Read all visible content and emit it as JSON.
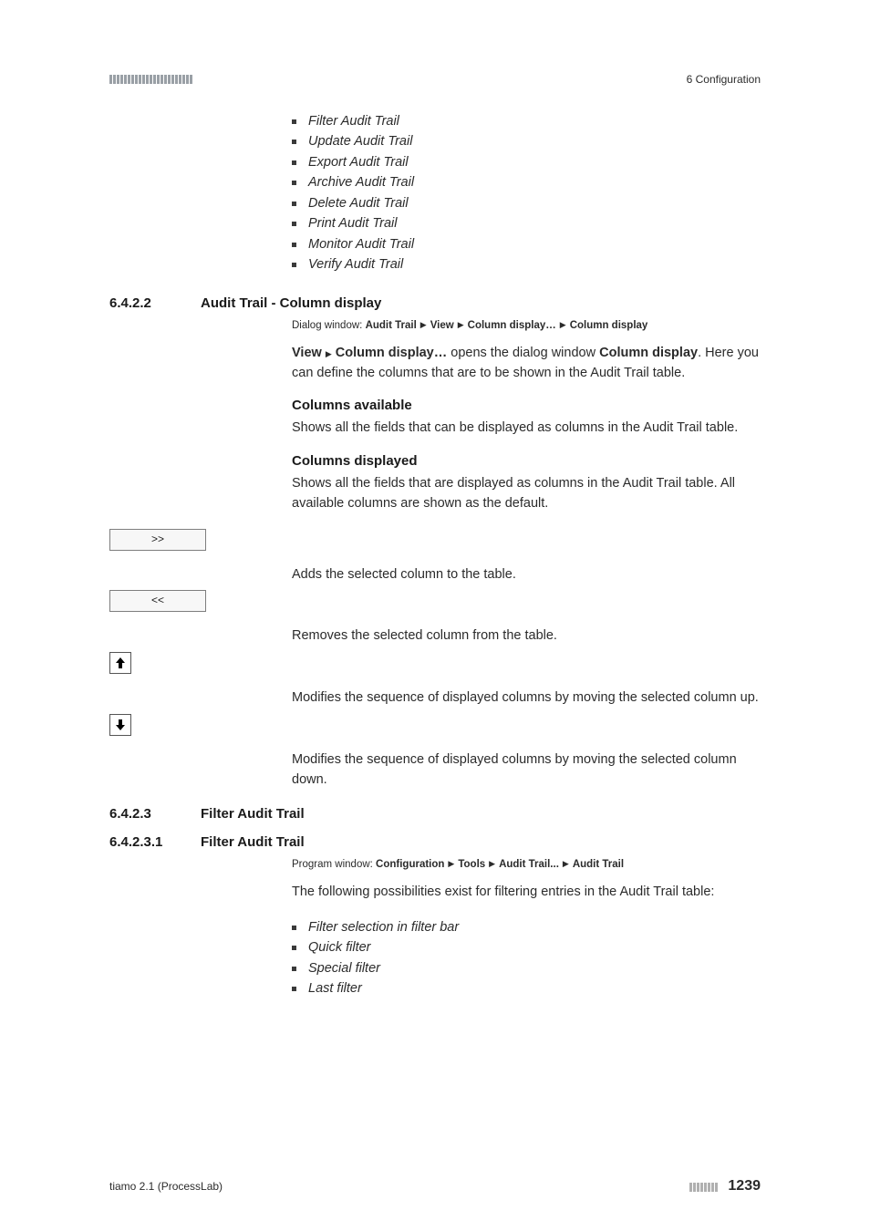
{
  "header": {
    "chapter": "6 Configuration"
  },
  "intro_bullets": [
    "Filter Audit Trail",
    "Update Audit Trail",
    "Export Audit Trail",
    "Archive Audit Trail",
    "Delete Audit Trail",
    "Print Audit Trail",
    "Monitor Audit Trail",
    "Verify Audit Trail"
  ],
  "sections": {
    "s1": {
      "num": "6.4.2.2",
      "title": "Audit Trail - Column display",
      "dialog_label": "Dialog window:",
      "dialog_path": [
        "Audit Trail",
        "View",
        "Column display…",
        "Column display"
      ],
      "para_lead_bold1": "View",
      "para_lead_bold2": "Column display…",
      "para_mid": " opens the dialog window ",
      "para_bold3": "Column display",
      "para_tail": ". Here you can define the columns that are to be shown in the Audit Trail table.",
      "cols_avail_head": "Columns available",
      "cols_avail_body": "Shows all the fields that can be displayed as columns in the Audit Trail table.",
      "cols_disp_head": "Columns displayed",
      "cols_disp_body": "Shows all the fields that are displayed as columns in the Audit Trail table. All available columns are shown as the default.",
      "controls": {
        "add_label": ">>",
        "add_desc": "Adds the selected column to the table.",
        "rem_label": "<<",
        "rem_desc": "Removes the selected column from the table.",
        "up_desc": "Modifies the sequence of displayed columns by moving the selected column up.",
        "down_desc": "Modifies the sequence of displayed columns by moving the selected column down."
      }
    },
    "s2": {
      "num": "6.4.2.3",
      "title": "Filter Audit Trail"
    },
    "s3": {
      "num": "6.4.2.3.1",
      "title": "Filter Audit Trail",
      "program_label": "Program window:",
      "program_path": [
        "Configuration",
        "Tools",
        "Audit Trail...",
        "Audit Trail"
      ],
      "intro": "The following possibilities exist for filtering entries in the Audit Trail table:",
      "bullets": [
        "Filter selection in filter bar",
        "Quick filter",
        "Special filter",
        "Last filter"
      ]
    }
  },
  "footer": {
    "product": "tiamo 2.1 (ProcessLab)",
    "page": "1239"
  }
}
